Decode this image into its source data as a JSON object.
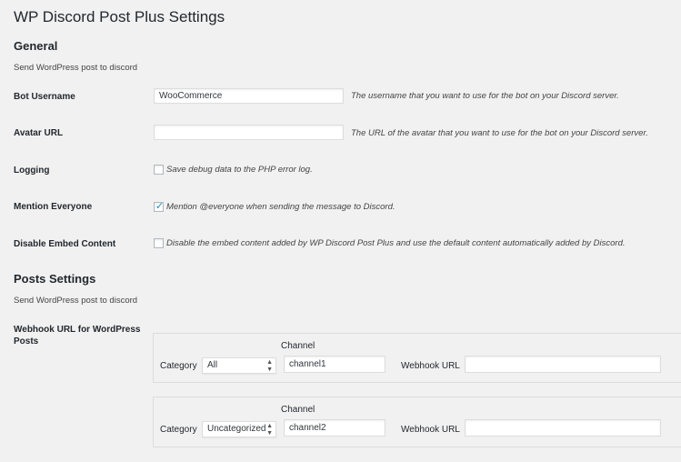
{
  "page": {
    "title": "WP Discord Post Plus Settings"
  },
  "general": {
    "title": "General",
    "description": "Send WordPress post to discord",
    "bot_username": {
      "label": "Bot Username",
      "value": "WooCommerce",
      "hint": "The username that you want to use for the bot on your Discord server."
    },
    "avatar_url": {
      "label": "Avatar URL",
      "value": "",
      "hint": "The URL of the avatar that you want to use for the bot on your Discord server."
    },
    "logging": {
      "label": "Logging",
      "checked": false,
      "checkbox_label": "Save debug data to the PHP error log."
    },
    "mention_everyone": {
      "label": "Mention Everyone",
      "checked": true,
      "checkbox_label": "Mention @everyone when sending the message to Discord."
    },
    "disable_embed": {
      "label": "Disable Embed Content",
      "checked": false,
      "checkbox_label": "Disable the embed content added by WP Discord Post Plus and use the default content automatically added by Discord."
    }
  },
  "posts": {
    "title": "Posts Settings",
    "description": "Send WordPress post to discord",
    "webhook_label": "Webhook URL for WordPress Posts",
    "rows": [
      {
        "channel_heading": "Channel",
        "category_label": "Category",
        "category_value": "All",
        "channel_value": "channel1",
        "webhook_label": "Webhook URL",
        "webhook_value": ""
      },
      {
        "channel_heading": "Channel",
        "category_label": "Category",
        "category_value": "Uncategorized",
        "channel_value": "channel2",
        "webhook_label": "Webhook URL",
        "webhook_value": ""
      }
    ]
  },
  "icons": {
    "checkmark": "checkmark-icon",
    "select_arrows": "select-arrows-icon"
  },
  "colors": {
    "checkmark": "#1e8cbe",
    "background": "#f1f1f1"
  }
}
